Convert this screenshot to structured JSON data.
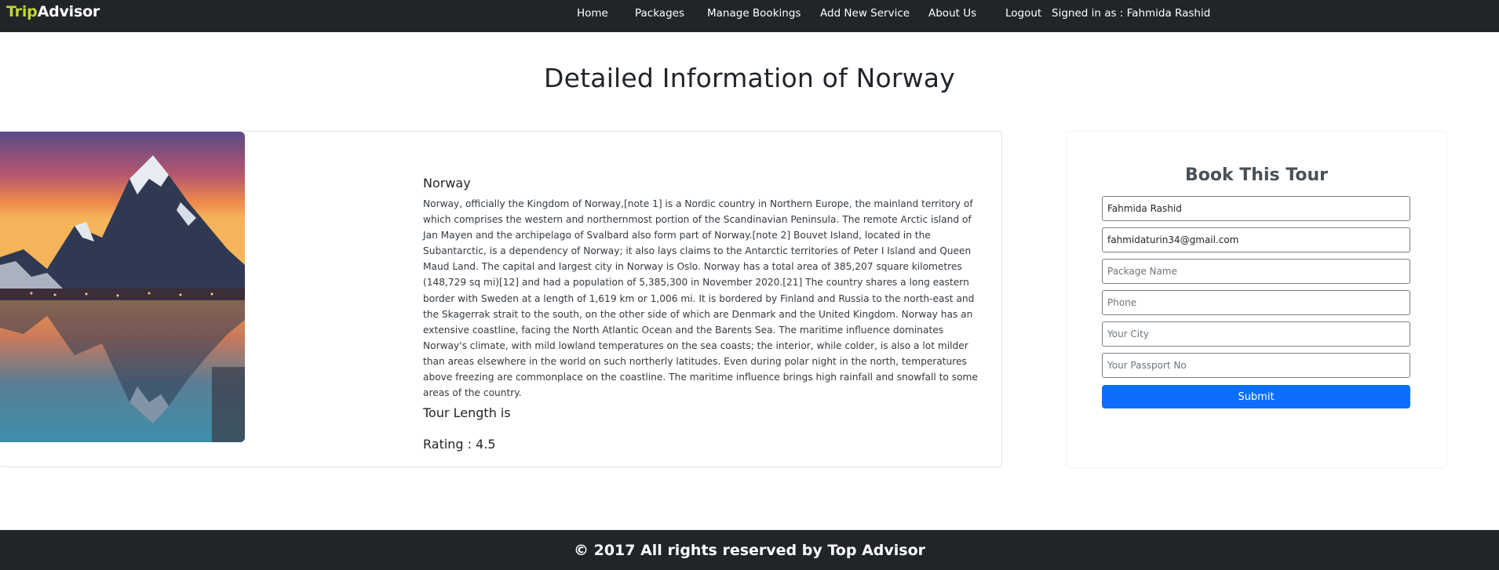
{
  "navbar": {
    "brand_part1": "Trip",
    "brand_part2": "Advisor",
    "links": [
      "Home",
      "Packages",
      "Manage Bookings",
      "Add New Service",
      "About Us",
      "Logout"
    ],
    "signed_in": "Signed in as : Fahmida Rashid"
  },
  "page": {
    "title": "Detailed Information of Norway"
  },
  "detail": {
    "image_alt": "Norway",
    "name": "Norway",
    "description": "Norway, officially the Kingdom of Norway,[note 1] is a Nordic country in Northern Europe, the mainland territory of which comprises the western and northernmost portion of the Scandinavian Peninsula. The remote Arctic island of Jan Mayen and the archipelago of Svalbard also form part of Norway.[note 2] Bouvet Island, located in the Subantarctic, is a dependency of Norway; it also lays claims to the Antarctic territories of Peter I Island and Queen Maud Land. The capital and largest city in Norway is Oslo. Norway has a total area of 385,207 square kilometres (148,729 sq mi)[12] and had a population of 5,385,300 in November 2020.[21] The country shares a long eastern border with Sweden at a length of 1,619 km or 1,006 mi. It is bordered by Finland and Russia to the north-east and the Skagerrak strait to the south, on the other side of which are Denmark and the United Kingdom. Norway has an extensive coastline, facing the North Atlantic Ocean and the Barents Sea. The maritime influence dominates Norway's climate, with mild lowland temperatures on the sea coasts; the interior, while colder, is also a lot milder than areas elsewhere in the world on such northerly latitudes. Even during polar night in the north, temperatures above freezing are commonplace on the coastline. The maritime influence brings high rainfall and snowfall to some areas of the country.",
    "tour_length": "Tour Length is",
    "rating": "Rating : 4.5"
  },
  "booking": {
    "title": "Book This Tour",
    "name_value": "Fahmida Rashid",
    "email_value": "fahmidaturin34@gmail.com",
    "package_placeholder": "Package Name",
    "phone_placeholder": "Phone",
    "city_placeholder": "Your City",
    "passport_placeholder": "Your Passport No",
    "submit_label": "Submit"
  },
  "footer": {
    "text": "© 2017 All rights reserved by Top Advisor"
  },
  "colors": {
    "navbar_bg": "#212529",
    "brand_accent": "#c3d82a",
    "primary": "#0d6efd"
  }
}
